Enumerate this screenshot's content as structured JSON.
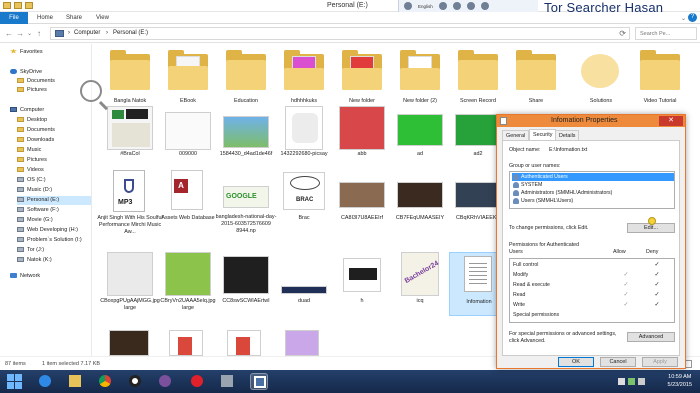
{
  "window": {
    "title": "Personal (E:)"
  },
  "watermark": "Tor Searcher Hasan",
  "system_strip": {
    "language": "English"
  },
  "ribbon": {
    "tabs": [
      "File",
      "Home",
      "Share",
      "View"
    ]
  },
  "address": {
    "crumbs": [
      "Computer",
      "Personal (E:)"
    ],
    "separator": "›",
    "search_placeholder": "Search Pe..."
  },
  "nav": {
    "favorites": "Favorites",
    "skydrive": "SkyDrive",
    "skydrive_items": [
      "Documents",
      "Pictures"
    ],
    "computer": "Computer",
    "computer_items": [
      "Desktop",
      "Documents",
      "Downloads",
      "Music",
      "Pictures",
      "Videos",
      "OS (C:)",
      "Music (D:)",
      "Personal (E:)",
      "Software (F:)",
      "Movie (G:)",
      "Web Developing (H:)",
      "Problem`s Solution (I:)",
      "Tor (J:)",
      "Natok (K:)"
    ],
    "network": "Network"
  },
  "files": {
    "row1": [
      "Bangla Natok",
      "EBook",
      "Education",
      "hdhhhkuks",
      "New folder",
      "New folder (2)",
      "Screen Record",
      "Share",
      "Solutions",
      "Video Tutorial"
    ],
    "row2": [
      "#BraCol",
      "009000",
      "1584430_d4ad1de46f",
      "1432292680-picsay",
      "abb",
      "ad",
      "ad2",
      "",
      "",
      ""
    ],
    "row3": [
      "Anjit Singh With His Soulful Performance Mirchi Music Aw...",
      "Assets Web Database",
      "bangladesh-national-day-2015-603572576609 8944.np",
      "Brac",
      "CA8I3I7U8AEEIrf",
      "CB7FEqUMAASEIY",
      "CBqKRhVIAEEKV",
      "",
      "",
      ""
    ],
    "row4": [
      "CBoxpgPUgAAjMGG.jpg large",
      "CBryVn2UAAA5elq.jpg large",
      "CC8swSCWIAErtwI",
      "duad",
      "h",
      "icq",
      "Infomation",
      "",
      "",
      ""
    ],
    "thumb_texts": {
      "brac": "BRAC",
      "google": "GOOGLE",
      "mp3": "MP3",
      "bachelor": "Bachelor24"
    }
  },
  "status": {
    "items_count": "87 items",
    "selected": "1 item selected  7.17 KB"
  },
  "taskbar": {
    "time": "10:59 AM",
    "date": "5/23/2015"
  },
  "dialog": {
    "title": "Infomation Properties",
    "tabs": [
      "General",
      "Security",
      "Details"
    ],
    "object_label": "Object name:",
    "object_value": "E:\\Infomation.txt",
    "groups_label": "Group or user names:",
    "groups": [
      "Authenticated Users",
      "SYSTEM",
      "Administrators (SMMHL\\Administrators)",
      "Users (SMMHL\\Users)"
    ],
    "change_text": "To change permissions, click Edit.",
    "edit_label": "Edit...",
    "perm_for": "Permissions for Authenticated",
    "perm_for2": "Users",
    "allow_label": "Allow",
    "deny_label": "Deny",
    "permissions": [
      {
        "name": "Full control",
        "allow": "",
        "deny": "✓"
      },
      {
        "name": "Modify",
        "allow": "✓",
        "deny": "✓"
      },
      {
        "name": "Read & execute",
        "allow": "✓",
        "deny": "✓"
      },
      {
        "name": "Read",
        "allow": "✓",
        "deny": "✓"
      },
      {
        "name": "Write",
        "allow": "✓",
        "deny": "✓"
      },
      {
        "name": "Special permissions",
        "allow": "",
        "deny": ""
      }
    ],
    "special_text": "For special permissions or advanced settings, click Advanced.",
    "advanced_label": "Advanced",
    "ok_label": "OK",
    "cancel_label": "Cancel",
    "apply_label": "Apply"
  }
}
